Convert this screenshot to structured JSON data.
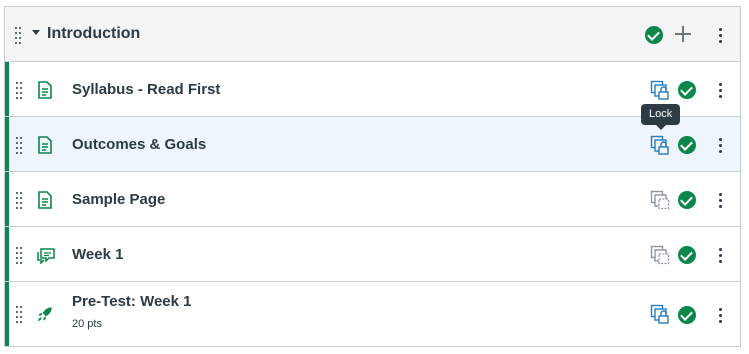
{
  "module": {
    "title": "Introduction",
    "published": true
  },
  "items": [
    {
      "title": "Syllabus - Read First",
      "type": "page",
      "lock_state": "locked",
      "published": true
    },
    {
      "title": "Outcomes & Goals",
      "type": "page",
      "lock_state": "locked",
      "published": true,
      "highlighted": true
    },
    {
      "title": "Sample Page",
      "type": "page",
      "lock_state": "unlocked",
      "published": true
    },
    {
      "title": "Week 1",
      "type": "discussion",
      "lock_state": "unlocked",
      "published": true
    },
    {
      "title": "Pre-Test: Week 1",
      "type": "quiz",
      "subtitle": "20 pts",
      "lock_state": "locked",
      "published": true
    }
  ],
  "tooltip": {
    "text": "Lock"
  },
  "colors": {
    "accent": "#0b874b",
    "link_blue": "#2b7abc",
    "muted_gray": "#8b969e",
    "highlight_row": "#eef5fc"
  },
  "icons": {
    "drag": "drag-handle-icon",
    "collapse": "caret-down-icon",
    "add": "plus-icon",
    "menu": "kebab-icon",
    "published": "check-circle-icon",
    "page": "document-icon",
    "discussion": "discussion-icon",
    "quiz": "rocket-icon",
    "lock": "blueprint-lock-icon"
  }
}
